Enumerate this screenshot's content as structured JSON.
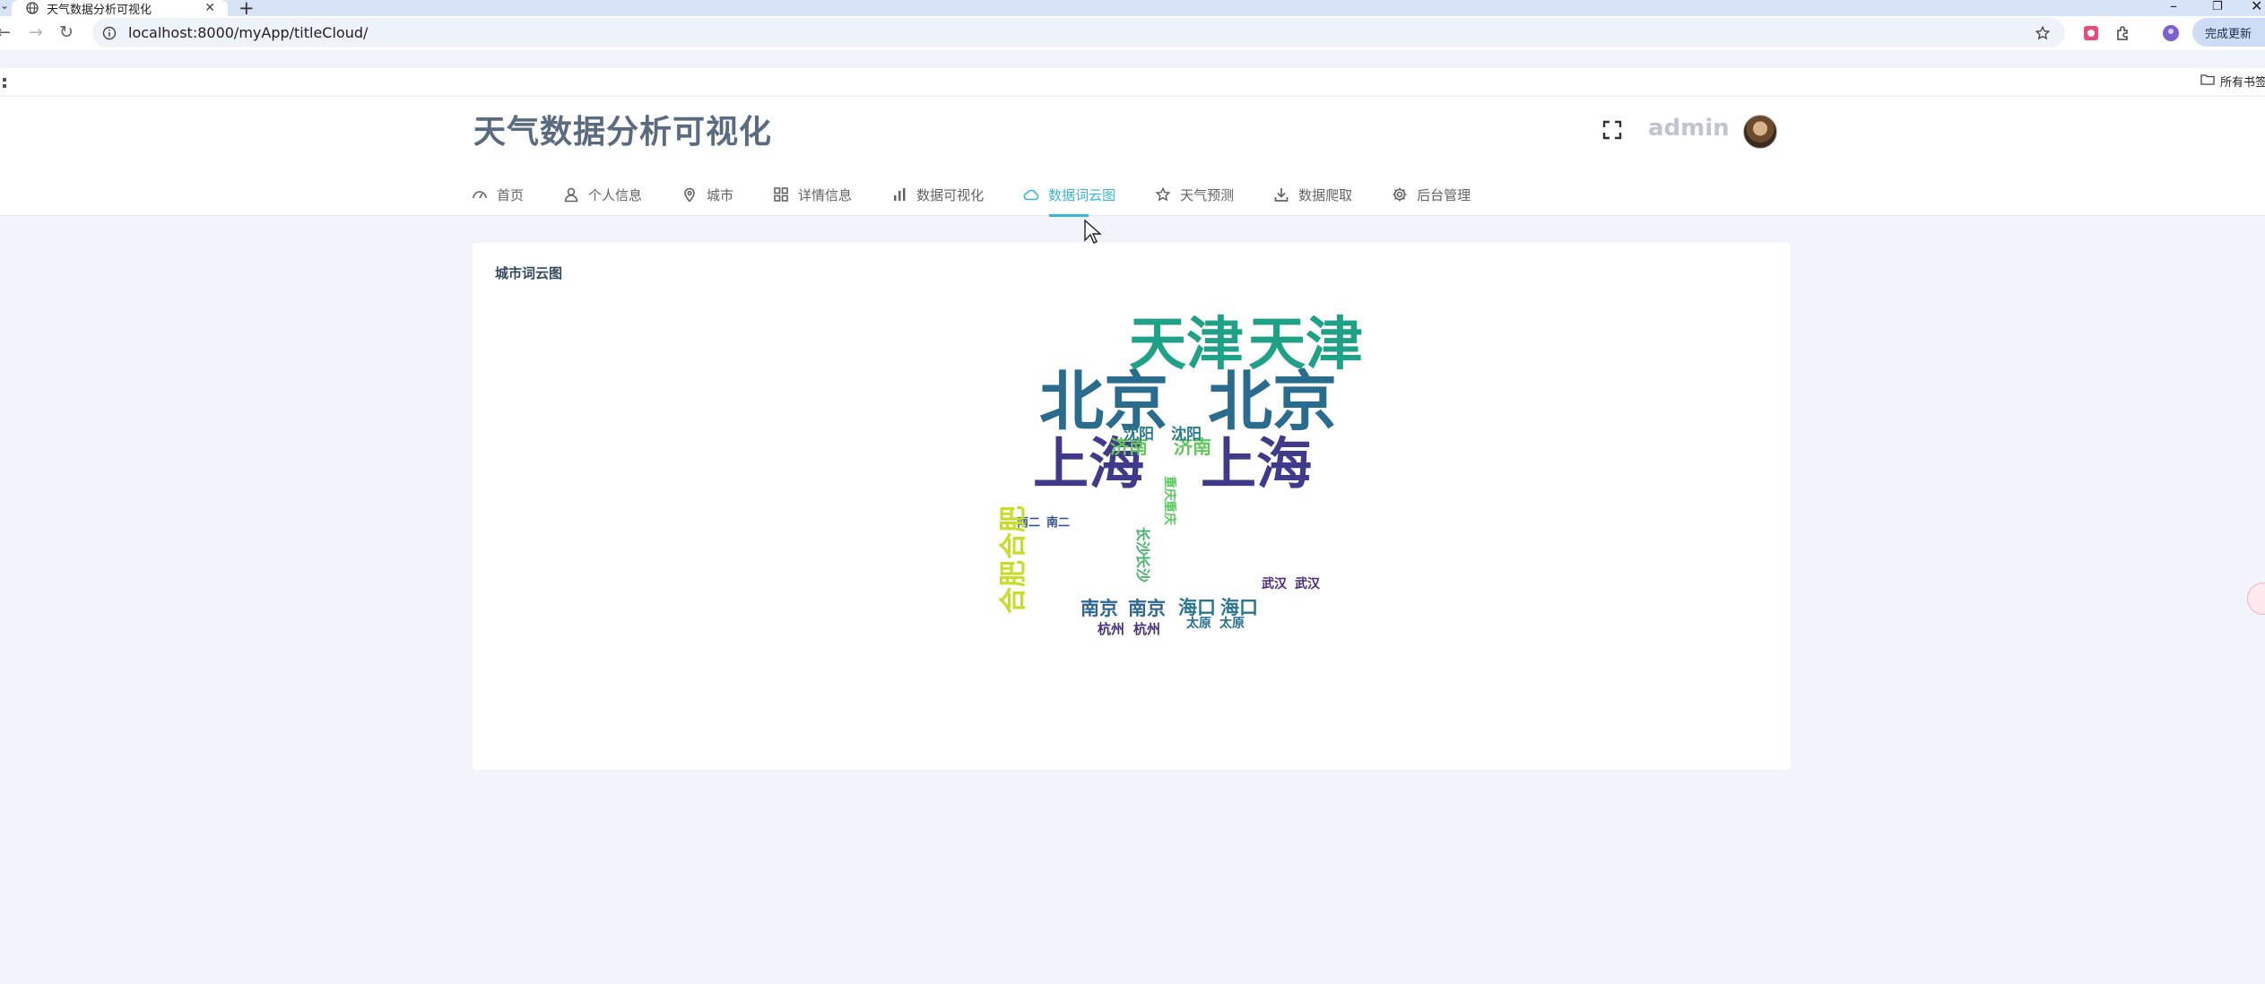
{
  "browser": {
    "tab_title": "天气数据分析可视化",
    "url": "localhost:8000/myApp/titleCloud/",
    "update_button": "完成更新",
    "bookmarks_all": "所有书签",
    "icons": {
      "tab_dropdown": "chevron-down-icon",
      "tab_site": "globe-icon",
      "tab_close": "close-icon",
      "new_tab": "plus-icon",
      "minimize": "minimize-icon",
      "restore": "restore-icon",
      "close_window": "close-icon",
      "back": "back-arrow-icon",
      "forward": "forward-arrow-icon",
      "reload": "reload-icon",
      "site_info": "info-icon",
      "bookmark": "star-icon",
      "extension": "puzzle-icon",
      "apps": "apps-grid-icon",
      "folder": "folder-icon"
    }
  },
  "app": {
    "title": "天气数据分析可视化",
    "user": "admin",
    "menu": [
      {
        "label": "首页",
        "icon": "dashboard-icon",
        "active": false
      },
      {
        "label": "个人信息",
        "icon": "user-icon",
        "active": false
      },
      {
        "label": "城市",
        "icon": "location-pin-icon",
        "active": false
      },
      {
        "label": "详情信息",
        "icon": "grid-icon",
        "active": false
      },
      {
        "label": "数据可视化",
        "icon": "bar-chart-icon",
        "active": false
      },
      {
        "label": "数据词云图",
        "icon": "cloud-icon",
        "active": true
      },
      {
        "label": "天气预测",
        "icon": "star-icon",
        "active": false
      },
      {
        "label": "数据爬取",
        "icon": "download-icon",
        "active": false
      },
      {
        "label": "后台管理",
        "icon": "gear-icon",
        "active": false
      }
    ],
    "accent_color": "#37b7d3"
  },
  "card": {
    "title": "城市词云图"
  },
  "wordcloud": {
    "words": [
      {
        "text": "北京",
        "color": "#2a6c8e"
      },
      {
        "text": "北京",
        "color": "#2a6c8e"
      },
      {
        "text": "上海",
        "color": "#3f3a8a"
      },
      {
        "text": "上海",
        "color": "#3f3a8a"
      },
      {
        "text": "天津",
        "color": "#1fa187"
      },
      {
        "text": "天津",
        "color": "#1fa187"
      },
      {
        "text": "济南",
        "color": "#63c65c"
      },
      {
        "text": "济南",
        "color": "#63c65c"
      },
      {
        "text": "沈阳",
        "color": "#2b7c8c"
      },
      {
        "text": "沈阳",
        "color": "#2b7c8c"
      },
      {
        "text": "南京",
        "color": "#31668f"
      },
      {
        "text": "南京",
        "color": "#31668f"
      },
      {
        "text": "海口",
        "color": "#2a778e"
      },
      {
        "text": "海口",
        "color": "#2a778e"
      },
      {
        "text": "武汉",
        "color": "#48287a"
      },
      {
        "text": "武汉",
        "color": "#48287a"
      },
      {
        "text": "杭州",
        "color": "#46327e"
      },
      {
        "text": "杭州",
        "color": "#46327e"
      },
      {
        "text": "太原",
        "color": "#2a6f8e"
      },
      {
        "text": "太原",
        "color": "#2a6f8e"
      },
      {
        "text": "南二",
        "color": "#33538d"
      },
      {
        "text": "南二",
        "color": "#33538d"
      },
      {
        "text": "合肥",
        "color": "#c8dc2a"
      },
      {
        "text": "合肥",
        "color": "#c8dc2a"
      },
      {
        "text": "长沙",
        "color": "#45b36a"
      },
      {
        "text": "长沙",
        "color": "#45b36a"
      },
      {
        "text": "重庆",
        "color": "#5ec962"
      },
      {
        "text": "重庆",
        "color": "#5ec962"
      }
    ]
  }
}
